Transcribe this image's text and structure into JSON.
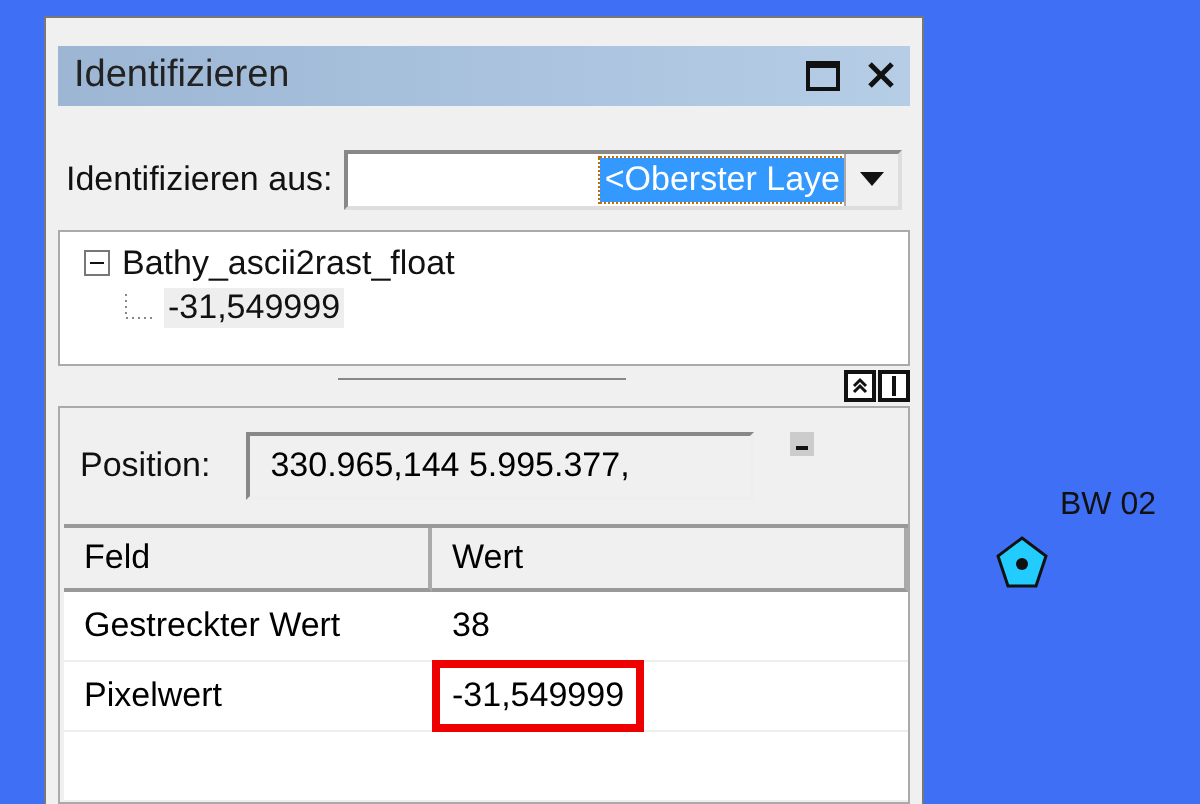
{
  "panel": {
    "title": "Identifizieren"
  },
  "identify_from": {
    "label": "Identifizieren aus:",
    "value": "<Oberster Laye"
  },
  "tree": [
    {
      "label": "Bathy_ascii2rast_float",
      "expanded": true,
      "children": [
        {
          "label": "-31,549999"
        }
      ]
    }
  ],
  "position": {
    "label": "Position:",
    "value": "330.965,144  5.995.377,"
  },
  "table": {
    "columns": [
      "Feld",
      "Wert"
    ],
    "rows": [
      {
        "field": "Gestreckter Wert",
        "value": "38",
        "highlighted": false
      },
      {
        "field": "Pixelwert",
        "value": "-31,549999",
        "highlighted": true
      }
    ]
  },
  "map": {
    "point_label": "BW 02"
  }
}
